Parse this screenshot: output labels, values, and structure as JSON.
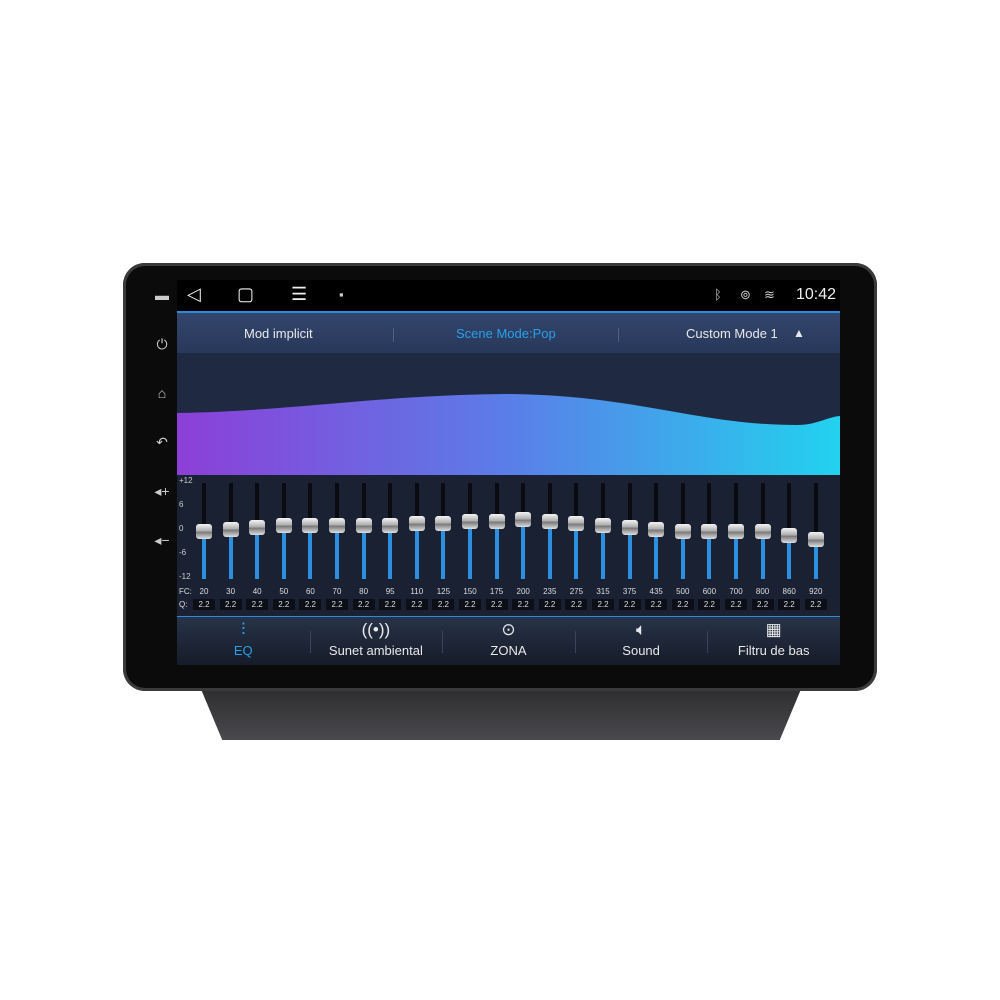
{
  "status_bar": {
    "time": "10:42",
    "icons": [
      "back-icon",
      "home-icon",
      "menu-icon",
      "gallery-icon",
      "bluetooth-icon",
      "location-icon",
      "wifi-icon"
    ]
  },
  "header": {
    "left": "Mod implicit",
    "center": "Scene Mode:Pop",
    "right": "Custom Mode 1",
    "accent": "#2aa0ea"
  },
  "eq": {
    "scale": [
      "+12",
      "6",
      "0",
      "-6",
      "-12"
    ],
    "range": [
      -12,
      12
    ],
    "fc_label": "FC:",
    "q_label": "Q:",
    "bands": [
      {
        "fc": "20",
        "q": "2.2",
        "gain": 0
      },
      {
        "fc": "30",
        "q": "2.2",
        "gain": 0.5
      },
      {
        "fc": "40",
        "q": "2.2",
        "gain": 1
      },
      {
        "fc": "50",
        "q": "2.2",
        "gain": 1.5
      },
      {
        "fc": "60",
        "q": "2.2",
        "gain": 1.5
      },
      {
        "fc": "70",
        "q": "2.2",
        "gain": 1.5
      },
      {
        "fc": "80",
        "q": "2.2",
        "gain": 1.5
      },
      {
        "fc": "95",
        "q": "2.2",
        "gain": 1.5
      },
      {
        "fc": "110",
        "q": "2.2",
        "gain": 2
      },
      {
        "fc": "125",
        "q": "2.2",
        "gain": 2
      },
      {
        "fc": "150",
        "q": "2.2",
        "gain": 2.5
      },
      {
        "fc": "175",
        "q": "2.2",
        "gain": 2.5
      },
      {
        "fc": "200",
        "q": "2.2",
        "gain": 3
      },
      {
        "fc": "235",
        "q": "2.2",
        "gain": 2.5
      },
      {
        "fc": "275",
        "q": "2.2",
        "gain": 2
      },
      {
        "fc": "315",
        "q": "2.2",
        "gain": 1.5
      },
      {
        "fc": "375",
        "q": "2.2",
        "gain": 1
      },
      {
        "fc": "435",
        "q": "2.2",
        "gain": 0.5
      },
      {
        "fc": "500",
        "q": "2.2",
        "gain": 0
      },
      {
        "fc": "600",
        "q": "2.2",
        "gain": 0
      },
      {
        "fc": "700",
        "q": "2.2",
        "gain": 0
      },
      {
        "fc": "800",
        "q": "2.2",
        "gain": 0
      },
      {
        "fc": "860",
        "q": "2.2",
        "gain": -1
      },
      {
        "fc": "920",
        "q": "2.2",
        "gain": -2
      }
    ]
  },
  "tabs": [
    {
      "label": "EQ",
      "icon": "equalizer-icon",
      "glyph": "⫶",
      "active": true
    },
    {
      "label": "Sunet ambiental",
      "icon": "surround-icon",
      "glyph": "((•))"
    },
    {
      "label": "ZONA",
      "icon": "target-icon",
      "glyph": "⊙"
    },
    {
      "label": "Sound",
      "icon": "speaker-icon",
      "glyph": "🔈︎"
    },
    {
      "label": "Filtru de bas",
      "icon": "bass-filter-icon",
      "glyph": "▦"
    }
  ],
  "side_buttons": [
    "mic-icon",
    "power-icon",
    "home-icon",
    "back-icon",
    "volume-up-icon",
    "volume-down-icon"
  ]
}
